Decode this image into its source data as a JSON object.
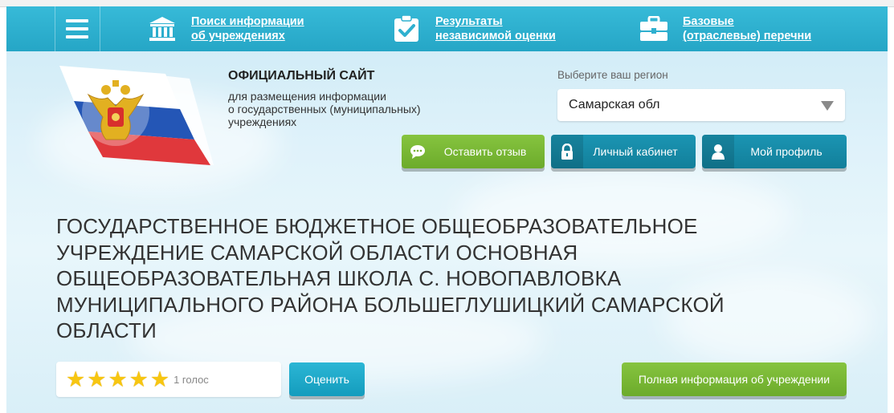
{
  "nav": {
    "items": [
      {
        "label_line1": "Поиск информации",
        "label_line2": "об учреждениях",
        "icon": "building-columns-icon"
      },
      {
        "label_line1": "Результаты",
        "label_line2": "независимой оценки",
        "icon": "clipboard-check-icon"
      },
      {
        "label_line1": "Базовые",
        "label_line2": "(отраслевые) перечни",
        "icon": "briefcase-icon"
      }
    ],
    "menu_icon": "menu-icon"
  },
  "header": {
    "site_title": "ОФИЦИАЛЬНЫЙ САЙТ",
    "site_subtitle_lines": [
      "для размещения информации",
      "о государственных (муниципальных)",
      "учреждениях"
    ],
    "region_label": "Выберите ваш регион",
    "region_value": "Самарская обл"
  },
  "buttons": {
    "feedback": "Оставить отзыв",
    "cabinet": "Личный кабинет",
    "profile": "Мой профиль"
  },
  "institution": {
    "name": "ГОСУДАРСТВЕННОЕ БЮДЖЕТНОЕ ОБЩЕОБРАЗОВАТЕЛЬНОЕ УЧРЕЖДЕНИЕ САМАРСКОЙ ОБЛАСТИ ОСНОВНАЯ ОБЩЕОБРАЗОВАТЕЛЬНАЯ ШКОЛА С. НОВОПАВЛОВКА МУНИЦИПАЛЬНОГО РАЙОНА БОЛЬШЕГЛУШИЦКИЙ САМАРСКОЙ ОБЛАСТИ",
    "rating_stars": 5,
    "rating_max": 5,
    "votes": "1 голос",
    "rate_button": "Оценить",
    "full_info_button": "Полная информация об учреждении"
  },
  "colors": {
    "nav_bg": "#2fb0cf",
    "green_button": "#7ab935",
    "teal_button": "#1688a5",
    "star": "#f7c611"
  }
}
